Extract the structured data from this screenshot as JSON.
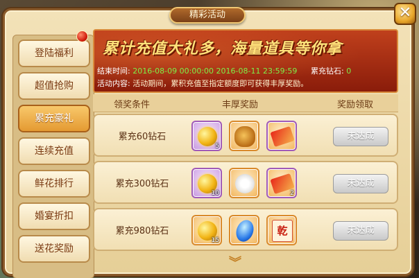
{
  "window": {
    "title": "精彩活动",
    "close_label": "✕"
  },
  "sidebar": {
    "items": [
      {
        "label": "登陆福利",
        "active": false,
        "badge": true
      },
      {
        "label": "超值抢购",
        "active": false
      },
      {
        "label": "累充豪礼",
        "active": true
      },
      {
        "label": "连续充值",
        "active": false
      },
      {
        "label": "鲜花排行",
        "active": false
      },
      {
        "label": "婚宴折扣",
        "active": false
      },
      {
        "label": "送花奖励",
        "active": false
      }
    ]
  },
  "banner": {
    "slogan": "累计充值大礼多，海量道具等你拿",
    "end_time_label": "结束时间:",
    "end_time_value": "2016-08-09 00:00:00 2016-08-11 23:59:59",
    "diamond_label": "累充钻石:",
    "diamond_value": "0",
    "content_label": "活动内容:",
    "content_value": "活动期间，累积充值至指定额度即可获得丰厚奖励。"
  },
  "table": {
    "headers": [
      "领奖条件",
      "丰厚奖励",
      "奖励领取"
    ],
    "rows": [
      {
        "condition": "累充60钻石",
        "rewards": [
          {
            "icon": "gold-coin-icon",
            "count": "5"
          },
          {
            "icon": "treasure-sack-icon",
            "count": ""
          },
          {
            "icon": "red-ticket-icon",
            "count": ""
          }
        ],
        "button": "未达成"
      },
      {
        "condition": "累充300钻石",
        "rewards": [
          {
            "icon": "gold-coin-icon",
            "count": "10"
          },
          {
            "icon": "white-flower-icon",
            "count": ""
          },
          {
            "icon": "red-ticket-icon",
            "count": "2"
          }
        ],
        "button": "未达成"
      },
      {
        "condition": "累充980钻石",
        "rewards": [
          {
            "icon": "gold-coin-icon",
            "count": "15"
          },
          {
            "icon": "blue-gem-icon",
            "count": ""
          },
          {
            "icon": "seal-card-icon",
            "count": "",
            "glyph": "乾"
          }
        ],
        "button": "未达成"
      }
    ]
  },
  "colors": {
    "accent": "#e49a32",
    "banner_red": "#b0341a",
    "highlight_green": "#7cf04a"
  }
}
